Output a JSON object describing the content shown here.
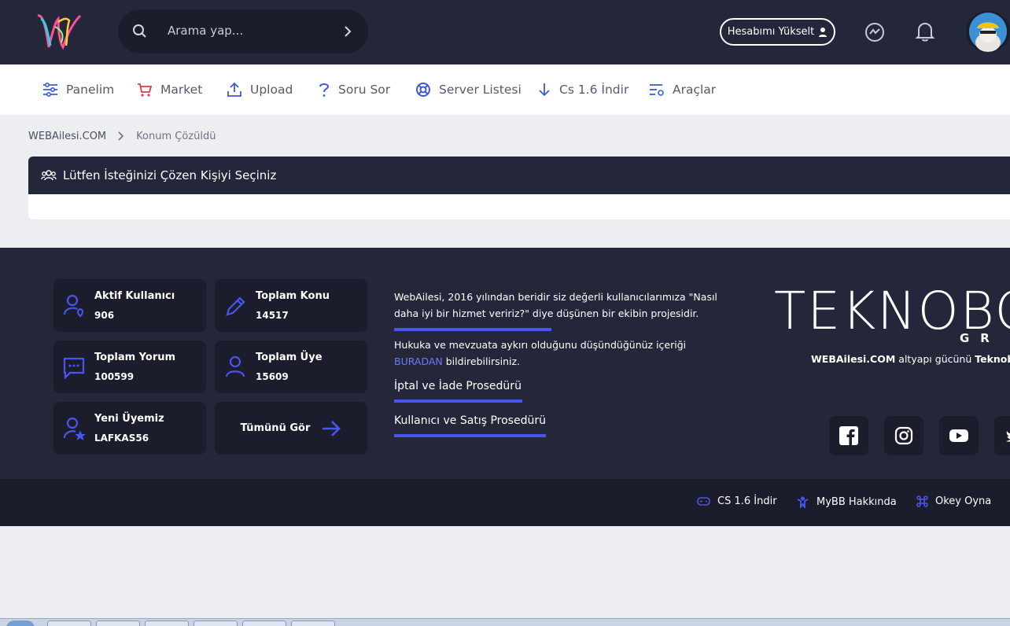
{
  "header": {
    "search_placeholder": "Arama yap...",
    "upgrade_label": "Hesabımı Yükselt"
  },
  "nav": {
    "items": [
      {
        "label": "Panelim",
        "icon": "sliders-icon"
      },
      {
        "label": "Market",
        "icon": "cart-icon"
      },
      {
        "label": "Upload",
        "icon": "upload-icon"
      },
      {
        "label": "Soru Sor",
        "icon": "question-icon"
      },
      {
        "label": "Server Listesi",
        "icon": "lifebuoy-icon"
      },
      {
        "label": "Cs 1.6 İndir",
        "icon": "download-arrow-icon"
      },
      {
        "label": "Araçlar",
        "icon": "tools-list-icon"
      }
    ]
  },
  "breadcrumb": {
    "home": "WEBAilesi.COM",
    "current": "Konum Çözüldü"
  },
  "panel": {
    "title": "Lütfen İsteğinizi Çözen Kişiyi Seçiniz"
  },
  "stats": [
    {
      "label": "Aktif Kullanıcı",
      "value": "906",
      "icon": "user-location-icon"
    },
    {
      "label": "Toplam Konu",
      "value": "14517",
      "icon": "pencil-icon"
    },
    {
      "label": "Toplam Yorum",
      "value": "100599",
      "icon": "comment-icon"
    },
    {
      "label": "Toplam Üye",
      "value": "15609",
      "icon": "user-icon"
    },
    {
      "label": "Yeni Üyemiz",
      "value": "LAFKAS56",
      "icon": "user-star-icon"
    }
  ],
  "see_all": "Tümünü Gör",
  "about": {
    "text": "WebAilesi, 2016 yılından beridir siz değerli kullanıcılarımıza \"Nasıl daha iyi bir hizmet veririz?\" diye düşünen bir ekibin projesidir.",
    "legal_prefix": "Hukuka ve mevzuata aykırı olduğunu düşündüğünüz içeriği",
    "legal_link": "BURADAN",
    "legal_suffix": "bildirebilirsiniz.",
    "link1": "İptal ve İade Prosedürü",
    "link2": "Kullanıcı ve Satış Prosedürü"
  },
  "brand": {
    "name": "TEKNOBO",
    "sub": "GR",
    "powered_bold": "WEBAilesi.COM",
    "powered_mid": "altyapı gücünü",
    "powered_end": "Teknobos"
  },
  "bottom_links": [
    {
      "label": "CS 1.6 İndir",
      "icon": "gamepad-icon"
    },
    {
      "label": "MyBB Hakkında",
      "icon": "mybb-icon"
    },
    {
      "label": "Okey Oyna",
      "icon": "command-icon"
    }
  ],
  "colors": {
    "dark": "#242739",
    "darker": "#1b1d2c",
    "accent": "#4a55f0"
  }
}
